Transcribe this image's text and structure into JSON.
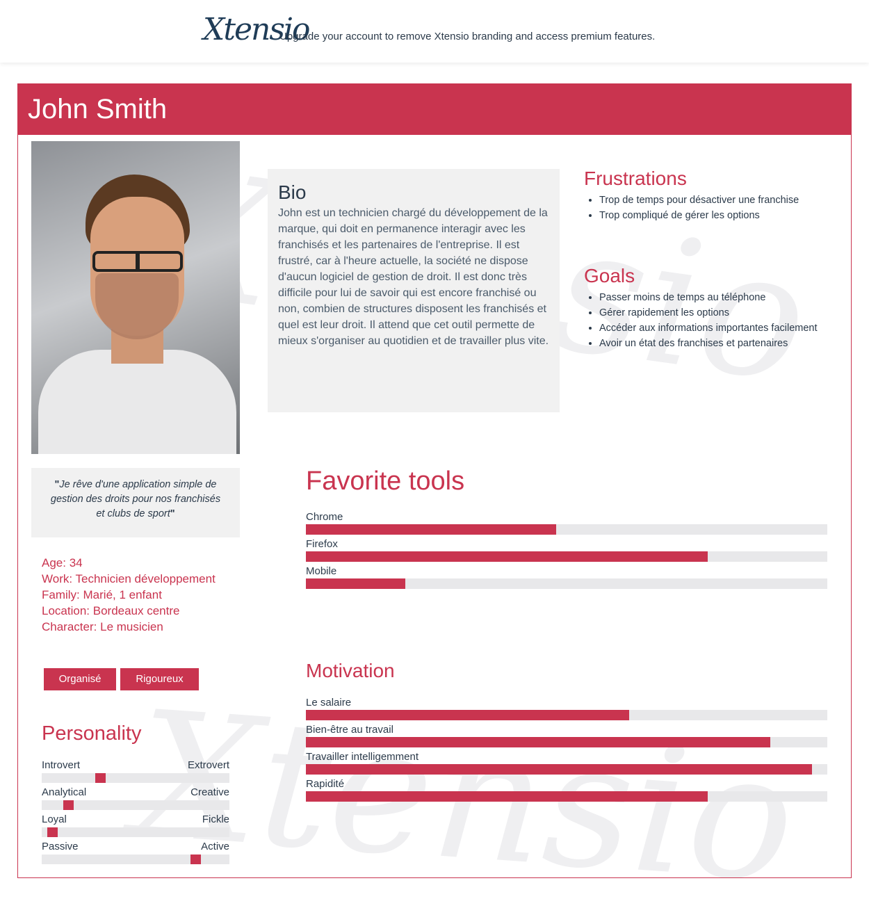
{
  "banner": {
    "logo_text": "Xtensio",
    "promo_text": "Upgrade your account to remove Xtensio branding and access premium features."
  },
  "persona": {
    "name": "John Smith",
    "quote": "Je rêve d'une application simple de gestion des droits pour nos franchisés et clubs de sport",
    "quote_open": "\"",
    "quote_close": "\"",
    "details": [
      {
        "label": "Age:",
        "value": "34"
      },
      {
        "label": "Work:",
        "value": "Technicien développement"
      },
      {
        "label": "Family:",
        "value": "Marié, 1 enfant"
      },
      {
        "label": "Location:",
        "value": "Bordeaux centre"
      },
      {
        "label": "Character:",
        "value": "Le musicien"
      }
    ],
    "tags": [
      "Organisé",
      "Rigoureux"
    ]
  },
  "personality": {
    "title": "Personality",
    "traits": [
      {
        "left": "Introvert",
        "right": "Extrovert",
        "level": 0.3
      },
      {
        "left": "Analytical",
        "right": "Creative",
        "level": 0.12
      },
      {
        "left": "Loyal",
        "right": "Fickle",
        "level": 0.03
      },
      {
        "left": "Passive",
        "right": "Active",
        "level": 0.84
      }
    ]
  },
  "bio": {
    "title": "Bio",
    "text": "John est un technicien chargé du développement de la marque, qui doit en permanence interagir avec les franchisés et les partenaires de l'entreprise. Il est frustré, car à l'heure actuelle, la société ne dispose d'aucun logiciel de gestion de droit. Il est donc très difficile pour lui de savoir qui est encore franchisé ou non, combien de structures disposent les franchisés et quel est leur droit. Il attend que cet outil permette de mieux s'organiser au quotidien et de travailler plus vite."
  },
  "frustrations": {
    "title": "Frustrations",
    "items": [
      "Trop de temps pour désactiver une franchise",
      "Trop compliqué de gérer les options"
    ]
  },
  "goals": {
    "title": "Goals",
    "items": [
      "Passer moins de temps au téléphone",
      "Gérer rapidement les options",
      "Accéder aux informations importantes facilement",
      "Avoir un état des franchises et partenaires"
    ]
  },
  "favorite_tools": {
    "title": "Favorite tools",
    "items": [
      {
        "label": "Chrome",
        "level": 0.48
      },
      {
        "label": "Firefox",
        "level": 0.77
      },
      {
        "label": "Mobile",
        "level": 0.19
      }
    ]
  },
  "motivation": {
    "title": "Motivation",
    "items": [
      {
        "label": "Le salaire",
        "level": 0.62
      },
      {
        "label": "Bien-être au travail",
        "level": 0.89
      },
      {
        "label": "Travailler intelligemment",
        "level": 0.97
      },
      {
        "label": "Rapidité",
        "level": 0.77
      }
    ]
  },
  "colors": {
    "accent": "#c9344f",
    "track": "#e8e8ea",
    "panel": "#f1f1f1",
    "text": "#2b3a4a"
  }
}
